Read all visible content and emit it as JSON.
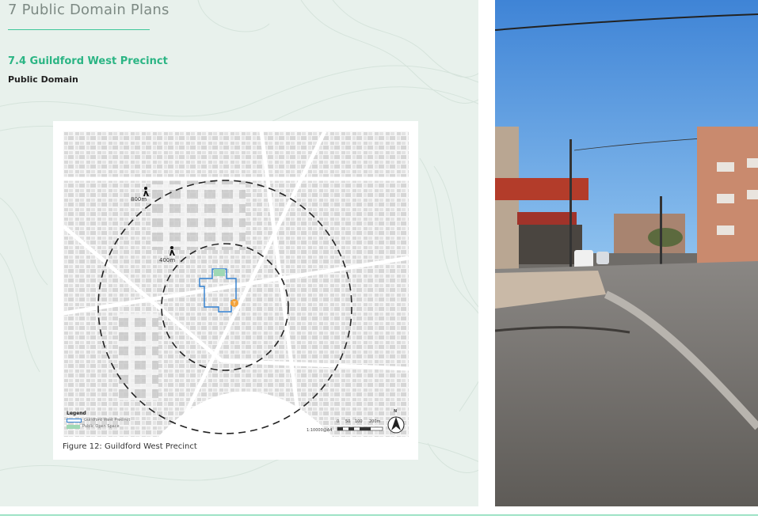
{
  "header": {
    "chapter_title": "7 Public Domain Plans",
    "section_title": "7.4 Guildford West Precinct",
    "subsection_title": "Public Domain"
  },
  "figure": {
    "caption": "Figure 12: Guildford West Precinct",
    "walk_labels": [
      "800m",
      "400m"
    ],
    "legend": {
      "title": "Legend",
      "items": [
        {
          "label": "Guildford West Precinct",
          "color": "#2f7fd0"
        },
        {
          "label": "Public Open Space",
          "color": "#9fd8b4"
        }
      ]
    },
    "scale_bar": {
      "ticks": [
        "0",
        "50",
        "100",
        "200m"
      ],
      "ratio": "1:10000@A4"
    },
    "north_label": "N",
    "station_marker_color": "#f2a23a"
  },
  "colors": {
    "accent_green": "#2bb584",
    "panel_background": "#e8f1ec",
    "rule_green": "#9ee3c6"
  }
}
